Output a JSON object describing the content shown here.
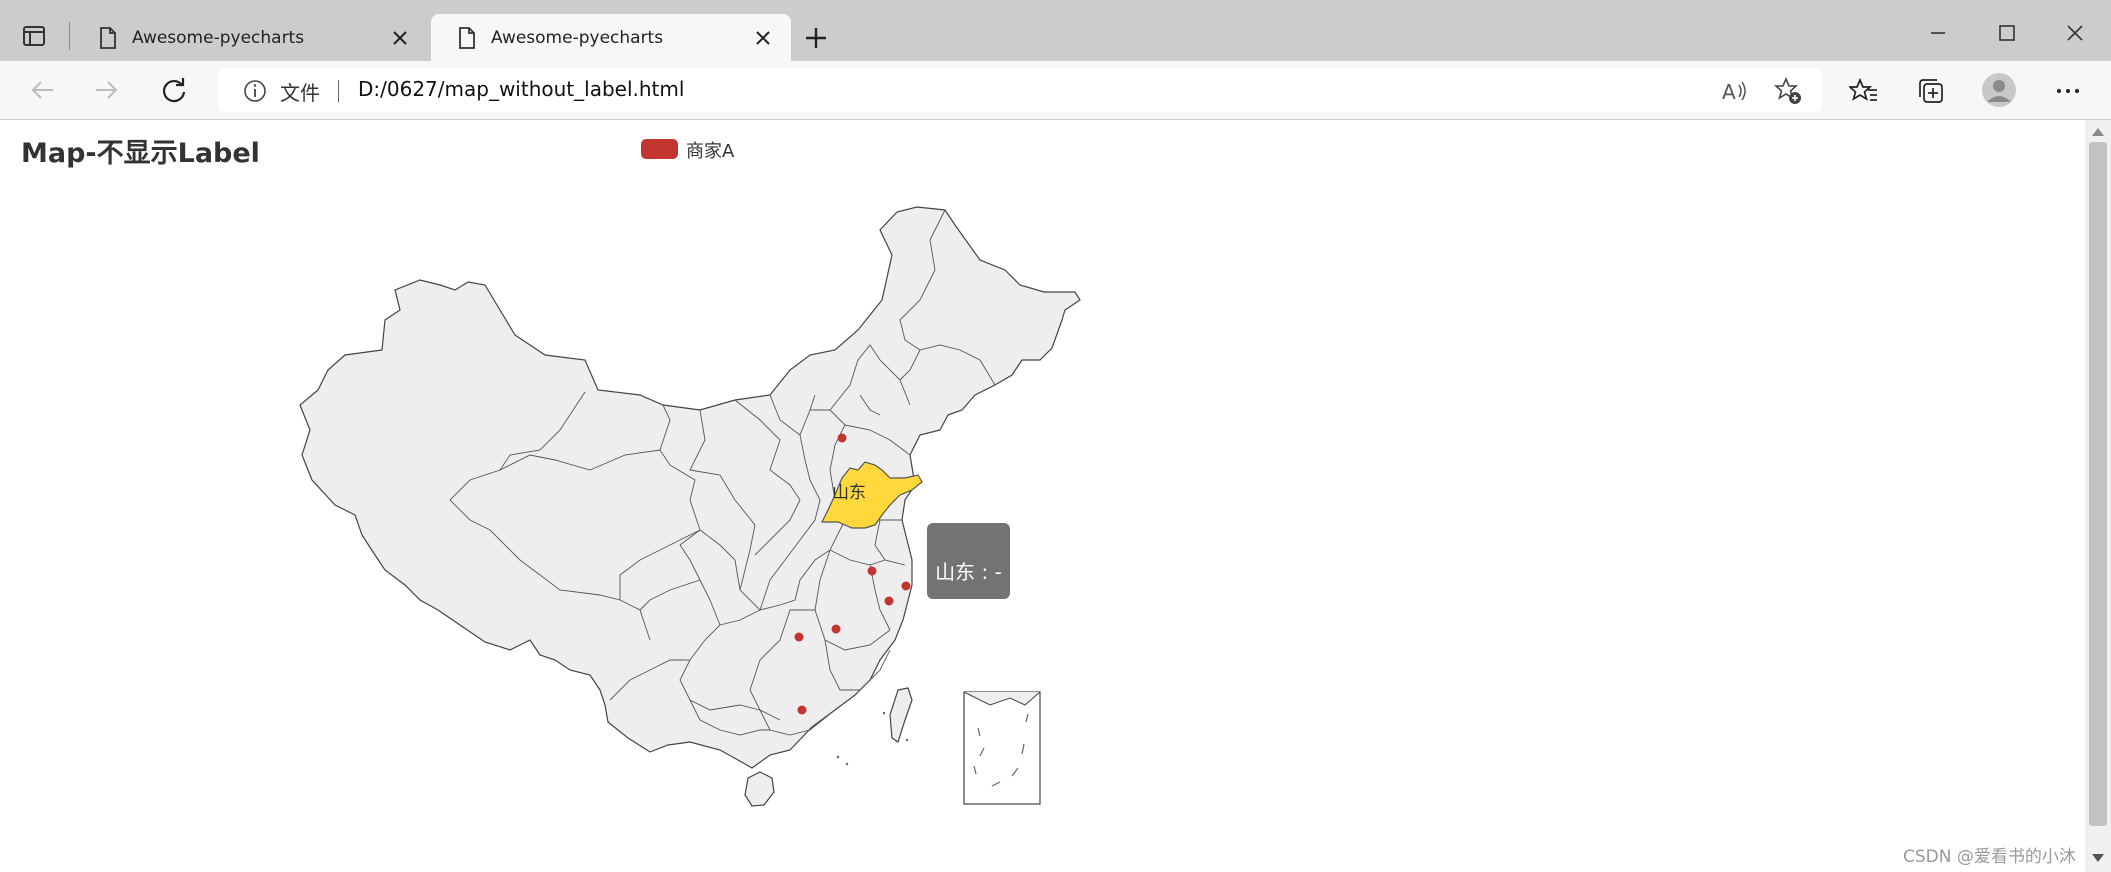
{
  "browser": {
    "tabs": [
      {
        "title": "Awesome-pyecharts",
        "active": false
      },
      {
        "title": "Awesome-pyecharts",
        "active": true
      }
    ],
    "address": {
      "security_label": "文件",
      "url": "D:/0627/map_without_label.html"
    }
  },
  "chart_data": {
    "type": "map",
    "map": "china",
    "title": "Map-不显示Label",
    "legend": [
      "商家A"
    ],
    "series": [
      {
        "name": "商家A",
        "color": "#c23531"
      }
    ],
    "highlighted_region": "山东",
    "highlight_color": "#ffd83b",
    "region_fill": "#eeeeee",
    "region_stroke": "#444444",
    "tooltip_text": "山东 : -",
    "region_label": "山东"
  },
  "watermark": "CSDN @爱看书的小沐"
}
